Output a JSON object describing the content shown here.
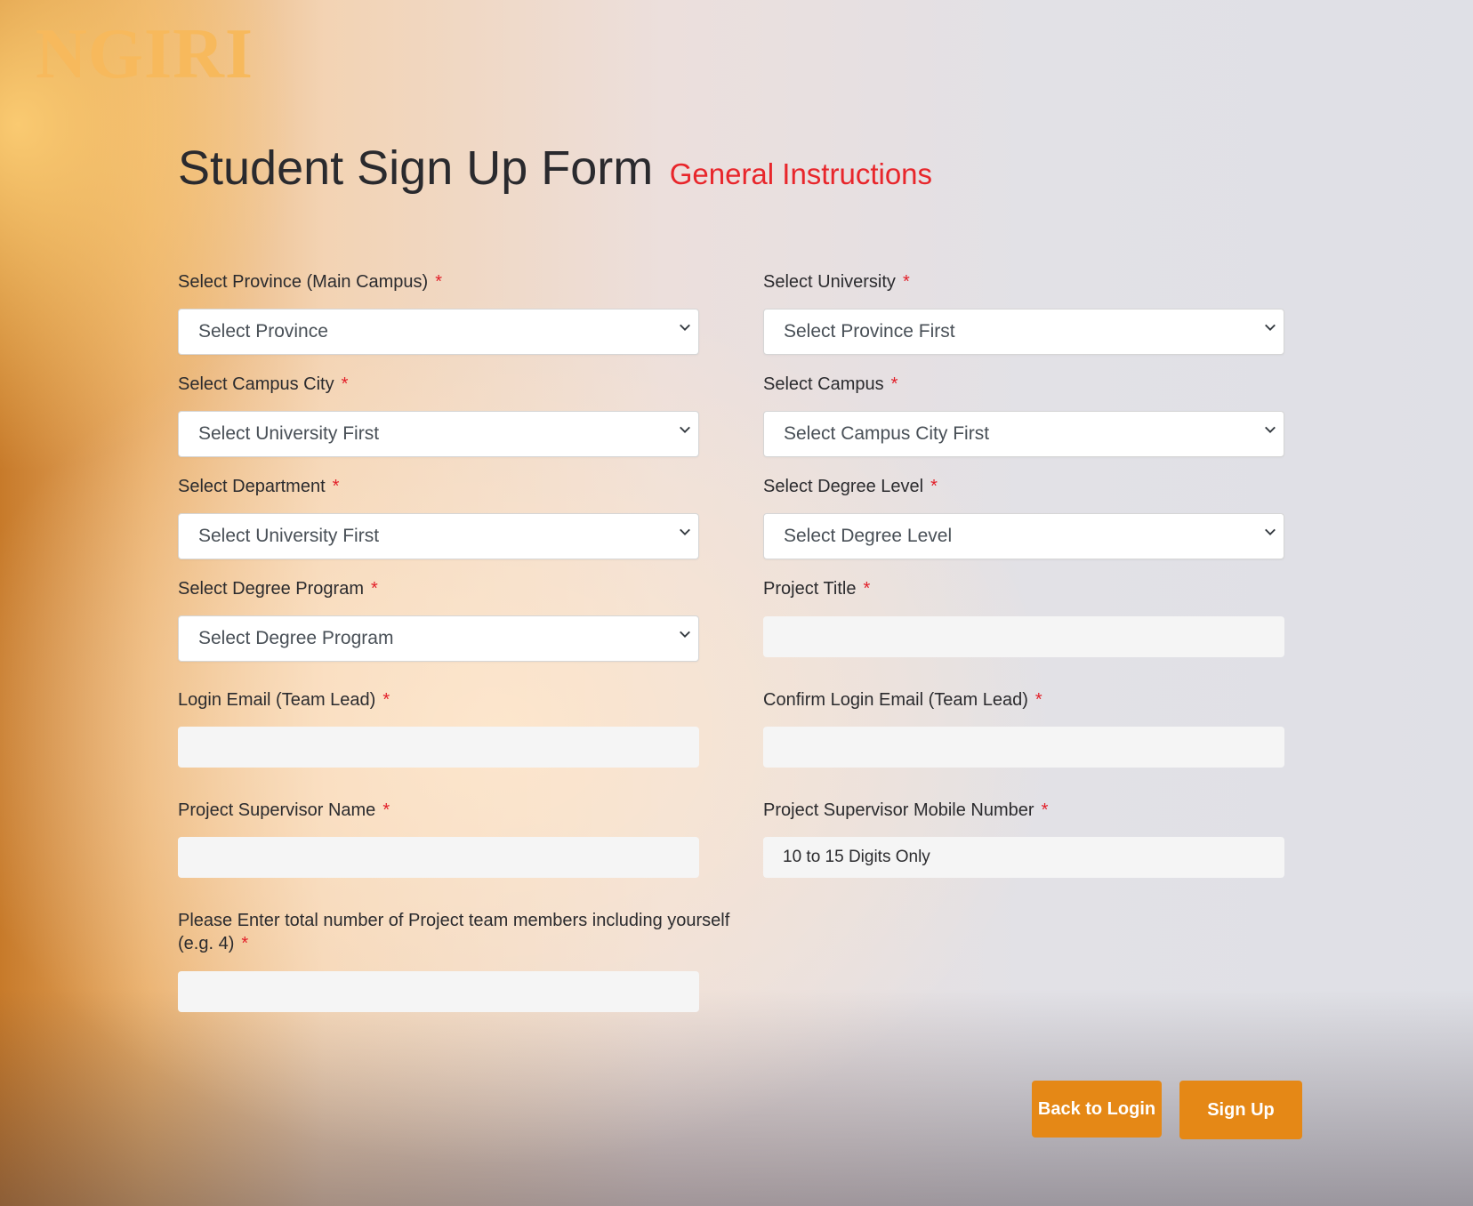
{
  "brand": {
    "logo_text": "NGIRI"
  },
  "header": {
    "title": "Student Sign Up Form",
    "instructions_link": "General Instructions"
  },
  "form": {
    "province": {
      "label": "Select Province (Main Campus)",
      "value": "Select Province"
    },
    "university": {
      "label": "Select University",
      "value": "Select Province First"
    },
    "campus_city": {
      "label": "Select Campus City",
      "value": "Select University First"
    },
    "campus": {
      "label": "Select Campus",
      "value": "Select Campus City First"
    },
    "department": {
      "label": "Select Department",
      "value": "Select University First"
    },
    "degree_level": {
      "label": "Select Degree Level",
      "value": "Select Degree Level"
    },
    "degree_program": {
      "label": "Select Degree Program",
      "value": "Select Degree Program"
    },
    "project_title": {
      "label": "Project Title",
      "value": ""
    },
    "login_email": {
      "label": "Login Email (Team Lead)",
      "value": ""
    },
    "confirm_email": {
      "label": "Confirm Login Email (Team Lead)",
      "value": ""
    },
    "supervisor_name": {
      "label": "Project Supervisor Name",
      "value": ""
    },
    "supervisor_mobile": {
      "label": "Project Supervisor Mobile Number",
      "placeholder": "10 to 15 Digits Only"
    },
    "team_members": {
      "label_line1": "Please Enter total number of Project team members including yourself",
      "label_line2": "(e.g. 4)",
      "value": ""
    },
    "required_marker": "*"
  },
  "actions": {
    "back_label": "Back to Login",
    "signup_label": "Sign Up"
  },
  "colors": {
    "accent": "#e58816",
    "required": "#e2202a",
    "logo": "#f7b95c",
    "link": "#e8262b"
  },
  "icons": {
    "select_chevron": "chevron-down-icon"
  }
}
